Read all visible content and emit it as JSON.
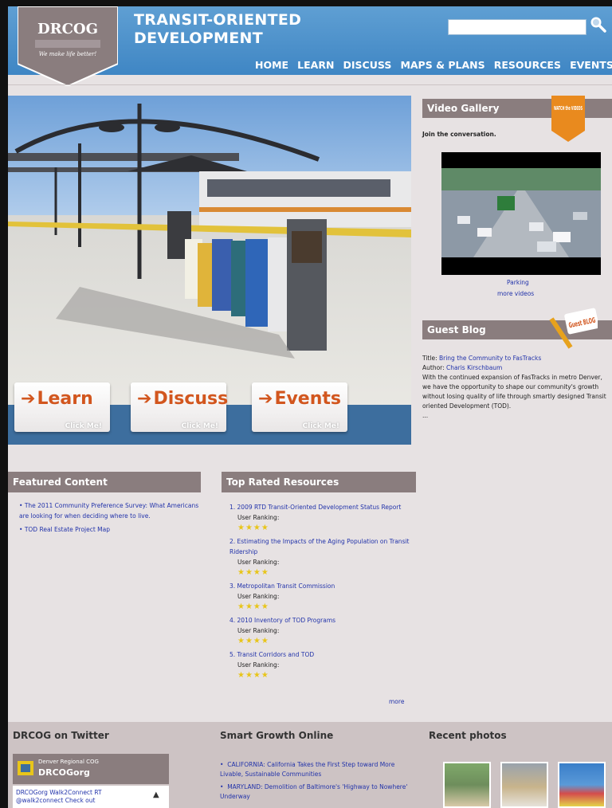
{
  "header": {
    "logo_text": "DRCOG",
    "logo_sub": "We make life better!",
    "title_line1": "TRANSIT-ORIENTED",
    "title_line2": "DEVELOPMENT",
    "nav": [
      "HOME",
      "LEARN",
      "DISCUSS",
      "MAPS & PLANS",
      "RESOURCES",
      "EVENTS"
    ]
  },
  "hero_buttons": [
    {
      "label": "Learn",
      "sub": "Click Me!"
    },
    {
      "label": "Discuss",
      "sub": "Click Me!"
    },
    {
      "label": "Events",
      "sub": "Click Me!"
    }
  ],
  "video_gallery": {
    "title": "Video Gallery",
    "badge": "WATCH the VIDEOS",
    "intro": "Join the conversation.",
    "caption": "Parking",
    "more": "more videos"
  },
  "guest_blog": {
    "title": "Guest Blog",
    "badge": "Guest BLOG",
    "title_prefix": "Title: ",
    "post_title": "Bring the Community to FasTracks",
    "author_prefix": "Author: ",
    "author": "Charis Kirschbaum",
    "body": "With the continued expansion of FasTracks in metro Denver, we have the opportunity to shape our community's growth without losing quality of life through smartly designed Transit oriented Development (TOD).",
    "ellipsis": "..."
  },
  "featured": {
    "title": "Featured Content",
    "items": [
      "The 2011 Community Preference Survey: What Americans are looking for when deciding where to live.",
      "TOD Real Estate Project Map"
    ]
  },
  "top_rated": {
    "title": "Top Rated Resources",
    "ranking_label": "User Ranking:",
    "items": [
      "1. 2009 RTD Transit-Oriented Development Status Report",
      "2. Estimating the Impacts of the Aging Population on Transit Ridership",
      "3. Metropolitan Transit Commission",
      "4. 2010 Inventory of TOD Programs",
      "5. Transit Corridors and TOD"
    ],
    "more": "more"
  },
  "footer": {
    "twitter_title": "DRCOG on Twitter",
    "twitter_org": "Denver Regional COG",
    "twitter_handle": "DRCOGorg",
    "tweet": "DRCOGorg Walk2Connect RT @walk2connect Check out",
    "smart_growth_title": "Smart Growth Online",
    "smart_growth_items": [
      "CALIFORNIA: California Takes the First Step toward More Livable, Sustainable Communities",
      "MARYLAND: Demolition of Baltimore's 'Highway to Nowhere' Underway"
    ],
    "photos_title": "Recent photos"
  },
  "colors": {
    "header_blue": "#4a8fcc",
    "section_header": "#8a7d7e",
    "accent_orange": "#d2561e",
    "link": "#2233aa"
  }
}
